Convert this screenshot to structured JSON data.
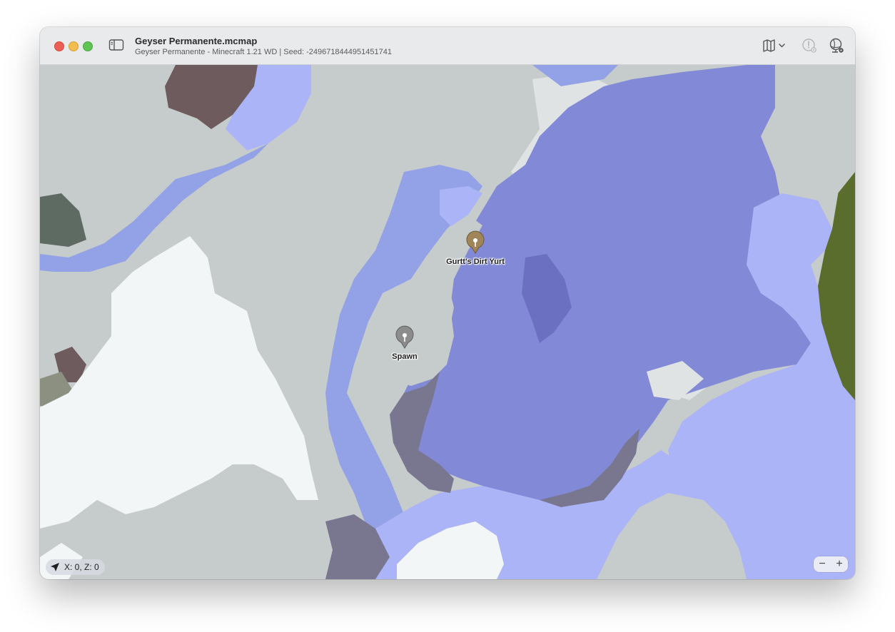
{
  "window": {
    "title": "Geyser Permanente.mcmap",
    "subtitle": "Geyser Permanente - Minecraft 1.21 WD | Seed: -2496718444951451741"
  },
  "toolbar": {
    "map_icon": "map-icon",
    "map_menu_icon": "chevron-down-icon",
    "location_icon": "location-settings-icon",
    "globe_icon": "globe-settings-icon"
  },
  "pins": [
    {
      "label": "Gurtt's Dirt Yurt",
      "color": "#a08559"
    },
    {
      "label": "Spawn",
      "color": "#8c8c8c"
    }
  ],
  "status": {
    "coordinates": "X: 0, Z: 0",
    "location_icon": "navigation-arrow-icon"
  },
  "zoom": {
    "out_label": "−",
    "in_label": "+"
  },
  "colors": {
    "plains": "#c6cbcb",
    "snow": "#f3f6f6",
    "ocean": "#8289d6",
    "deep_ocean": "#6c70c0",
    "shallow": "#aab4f6",
    "river": "#93a2e6",
    "mountain": "#797790",
    "forest": "#5a6d2c",
    "mesa": "#6e5b5e"
  }
}
